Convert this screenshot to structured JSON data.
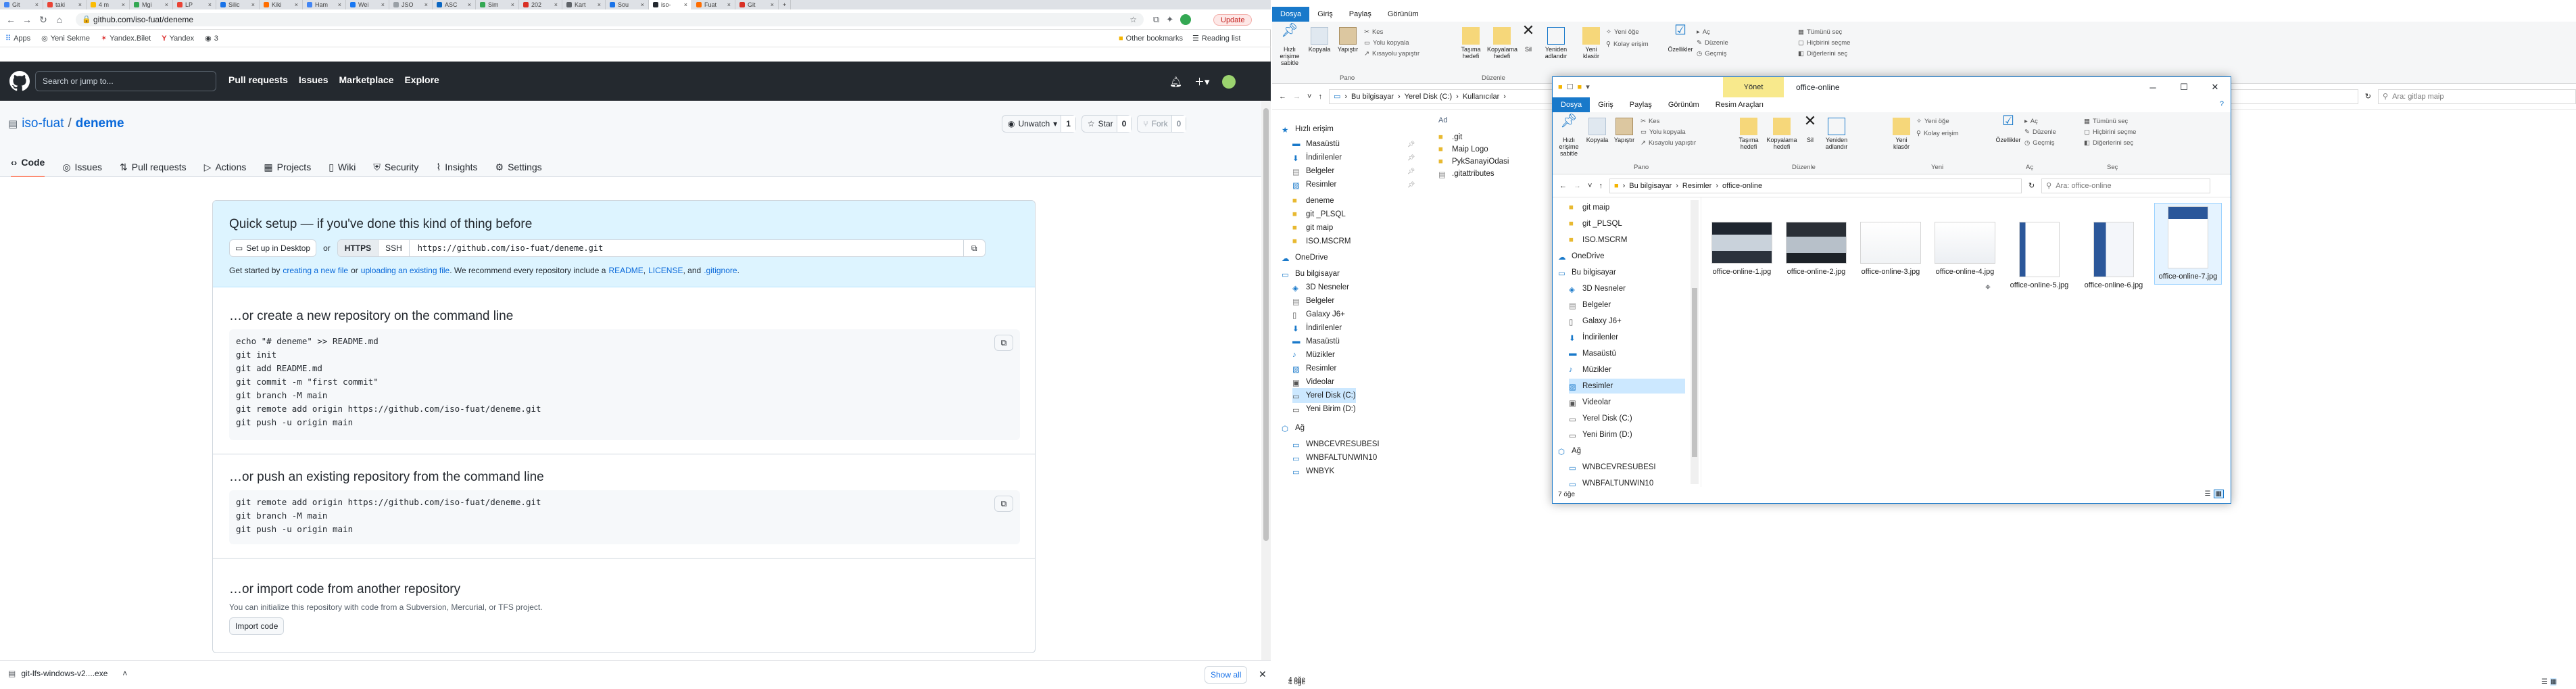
{
  "browser": {
    "tabs": [
      "Git",
      "taki",
      "4 m",
      "Mgi",
      "LP",
      "Silic",
      "Kiki",
      "Ham",
      "Wei",
      "JSO",
      "ASC",
      "Sim",
      "202",
      "Kart",
      "Sou",
      "iso-",
      "Fuat",
      "Git"
    ],
    "active_tab_index": 15,
    "url": "github.com/iso-fuat/deneme",
    "update_label": "Update",
    "bookmarks": [
      "Apps",
      "Yeni Sekme",
      "Yandex.Bilet",
      "Yandex",
      "3"
    ],
    "other_bookmarks": "Other bookmarks",
    "reading_list": "Reading list"
  },
  "github": {
    "search_placeholder": "Search or jump to...",
    "nav": [
      "Pull requests",
      "Issues",
      "Marketplace",
      "Explore"
    ],
    "owner": "iso-fuat",
    "separator": "/",
    "repo": "deneme",
    "unwatch_label": "Unwatch",
    "unwatch_count": "1",
    "star_label": "Star",
    "star_count": "0",
    "fork_label": "Fork",
    "fork_count": "0",
    "tabs": [
      "Code",
      "Issues",
      "Pull requests",
      "Actions",
      "Projects",
      "Wiki",
      "Security",
      "Insights",
      "Settings"
    ],
    "quick_setup": {
      "title": "Quick setup — if you've done this kind of thing before",
      "setup_desktop": "Set up in Desktop",
      "or": "or",
      "https": "HTTPS",
      "ssh": "SSH",
      "clone_url": "https://github.com/iso-fuat/deneme.git",
      "hint_prefix": "Get started by",
      "hint_link1": "creating a new file",
      "hint_or": "or",
      "hint_link2": "uploading an existing file",
      "hint_middle": ". We recommend every repository include a",
      "hint_readme": "README",
      "hint_comma": ",",
      "hint_license": "LICENSE",
      "hint_and": ", and",
      "hint_gitignore": ".gitignore",
      "hint_end": "."
    },
    "new_repo_title": "…or create a new repository on the command line",
    "new_repo_code": [
      "echo \"# deneme\" >> README.md",
      "git init",
      "git add README.md",
      "git commit -m \"first commit\"",
      "git branch -M main",
      "git remote add origin https://github.com/iso-fuat/deneme.git",
      "git push -u origin main"
    ],
    "push_existing_title": "…or push an existing repository from the command line",
    "push_existing_code": [
      "git remote add origin https://github.com/iso-fuat/deneme.git",
      "git branch -M main",
      "git push -u origin main"
    ],
    "import_title": "…or import code from another repository",
    "import_desc": "You can initialize this repository with code from a Subversion, Mercurial, or TFS project.",
    "import_button": "Import code"
  },
  "download_bar": {
    "file": "git-lfs-windows-v2....exe",
    "show_all": "Show all"
  },
  "explorer_back": {
    "ribbon_tabs": [
      "Dosya",
      "Giriş",
      "Paylaş",
      "Görünüm"
    ],
    "path": [
      "Bu bilgisayar",
      "Yerel Disk (C:)",
      "Kullanıcılar"
    ],
    "search_placeholder": "Ara: gitlap maip",
    "quick_access": "Hızlı erişim",
    "tree": [
      "Masaüstü",
      "İndirilenler",
      "Belgeler",
      "Resimler",
      "deneme",
      "git _PLSQL",
      "git maip",
      "ISO.MSCRM",
      "OneDrive",
      "Bu bilgisayar",
      "3D Nesneler",
      "Belgeler",
      "Galaxy J6+",
      "İndirilenler",
      "Masaüstü",
      "Müzikler",
      "Resimler",
      "Videolar",
      "Yerel Disk (C:)",
      "Yeni Birim (D:)",
      "Ağ",
      "WNBCEVRESUBESI",
      "WNBFALTUNWIN10",
      "WNBYK"
    ],
    "col_name": "Ad",
    "files": [
      ".git",
      "Maip Logo",
      "PykSanayiOdasi",
      ".gitattributes"
    ],
    "status": "4 öğe",
    "ribbon_labels": {
      "pin": "Hızlı erişime sabitle",
      "copy": "Kopyala",
      "paste": "Yapıştır",
      "cut": "Kes",
      "copy_path": "Yolu kopyala",
      "paste_shortcut": "Kısayolu yapıştır",
      "move": "Taşıma hedefi",
      "copy_to": "Kopyalama hedefi",
      "delete": "Sil",
      "rename": "Yeniden adlandır",
      "new_folder": "Yeni klasör",
      "new_item": "Yeni öğe",
      "easy_access": "Kolay erişim",
      "properties": "Özellikler",
      "open": "Aç",
      "edit": "Düzenle",
      "history": "Geçmiş",
      "select_all": "Tümünü seç",
      "select_none": "Hiçbirini seçme",
      "invert": "Diğerlerini seç",
      "pano": "Pano",
      "duzenle": "Düzenle"
    }
  },
  "explorer_front": {
    "title": "office-online",
    "manage_tab": "Yönet",
    "ribbon_tabs": [
      "Dosya",
      "Giriş",
      "Paylaş",
      "Görünüm",
      "Resim Araçları"
    ],
    "path": [
      "Bu bilgisayar",
      "Resimler",
      "office-online"
    ],
    "search_placeholder": "Ara: office-online",
    "tree": [
      "git maip",
      "git _PLSQL",
      "ISO.MSCRM",
      "OneDrive",
      "Bu bilgisayar",
      "3D Nesneler",
      "Belgeler",
      "Galaxy J6+",
      "İndirilenler",
      "Masaüstü",
      "Müzikler",
      "Resimler",
      "Videolar",
      "Yerel Disk (C:)",
      "Yeni Birim (D:)",
      "Ağ",
      "WNBCEVRESUBESI",
      "WNBFALTUNWIN10"
    ],
    "selected_tree_item": "Resimler",
    "files": [
      "office-online-1.jpg",
      "office-online-2.jpg",
      "office-online-3.jpg",
      "office-online-4.jpg",
      "office-online-5.jpg",
      "office-online-6.jpg",
      "office-online-7.jpg"
    ],
    "status": "7 öğe",
    "group_labels": {
      "pano": "Pano",
      "duzenle": "Düzenle",
      "yeni": "Yeni",
      "ac": "Aç",
      "sec": "Seç"
    },
    "ribbon_labels": {
      "pin": "Hızlı erişime sabitle",
      "copy": "Kopyala",
      "paste": "Yapıştır",
      "cut": "Kes",
      "copy_path": "Yolu kopyala",
      "paste_shortcut": "Kısayolu yapıştır",
      "move": "Taşıma hedefi",
      "copy_to": "Kopyalama hedefi",
      "delete": "Sil",
      "rename": "Yeniden adlandır",
      "new_folder": "Yeni klasör",
      "new_item": "Yeni öğe",
      "easy_access": "Kolay erişim",
      "properties": "Özellikler",
      "open": "Aç",
      "edit": "Düzenle",
      "history": "Geçmiş",
      "select_all": "Tümünü seç",
      "select_none": "Hiçbirini seçme",
      "invert": "Diğerlerini seç"
    }
  },
  "taskbar_status": "4 öğe",
  "colors": {
    "gh_header": "#24292f",
    "gh_link": "#0969da",
    "quick_setup_bg": "#ddf4ff",
    "explorer_accent": "#1979ca",
    "manage_tab": "#f8e98c",
    "tree_selected": "#cce8ff"
  }
}
